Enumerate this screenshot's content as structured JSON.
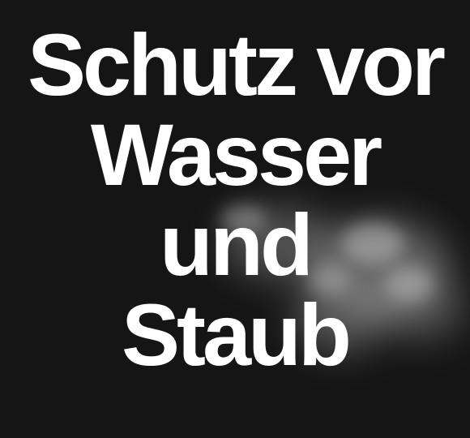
{
  "headline": {
    "line1": "Schutz vor",
    "line2": "Wasser",
    "line3": "und",
    "line4": "Staub"
  },
  "colors": {
    "background": "#151515",
    "text": "#ffffff",
    "smoke": "#d8d8d8"
  }
}
